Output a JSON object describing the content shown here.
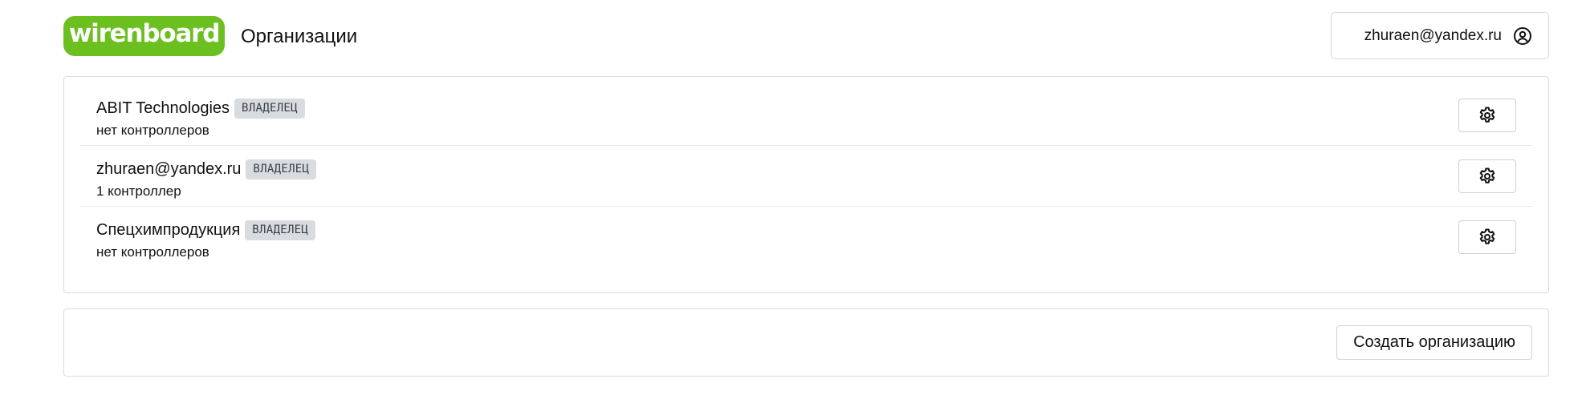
{
  "header": {
    "logo_text": "wirenboard",
    "title": "Организации",
    "user_email": "zhuraen@yandex.ru",
    "user_icon": "user-circle-icon"
  },
  "colors": {
    "brand_green": "#6bbf1f",
    "badge_bg": "#d8dbdf",
    "border": "#d9dce0"
  },
  "organizations": [
    {
      "name": "ABIT Technologies",
      "role": "ВЛАДЕЛЕЦ",
      "controllers": "нет контроллеров",
      "settings_icon": "gear-icon"
    },
    {
      "name": "zhuraen@yandex.ru",
      "role": "ВЛАДЕЛЕЦ",
      "controllers": "1 контроллер",
      "settings_icon": "gear-icon"
    },
    {
      "name": "Спецхимпродукция",
      "role": "ВЛАДЕЛЕЦ",
      "controllers": "нет контроллеров",
      "settings_icon": "gear-icon"
    }
  ],
  "footer": {
    "create_label": "Создать организацию"
  }
}
